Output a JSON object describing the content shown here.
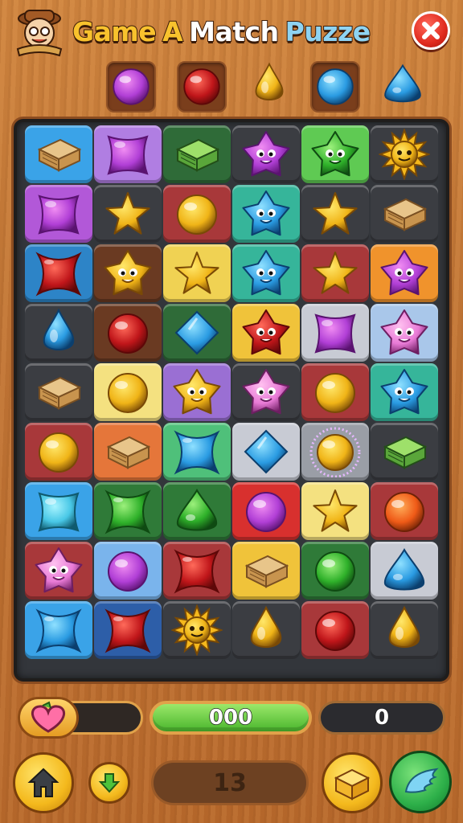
{
  "header": {
    "title_words": [
      {
        "text": "Game",
        "color": "#f8c22d"
      },
      {
        "text": "A",
        "color": "#f8c22d"
      },
      {
        "text": "Match",
        "color": "#ffffff"
      },
      {
        "text": "Puzze",
        "color": "#8ed3f2"
      }
    ],
    "logo_icon": "explorer-mascot-icon",
    "close_icon": "close-icon"
  },
  "next_row": [
    "purple-orb",
    "red-orb",
    "yellow-drop",
    "blue-orb",
    "blue-cone"
  ],
  "board": {
    "rows": 9,
    "cols": 6,
    "cells": [
      [
        {
          "bg": "#3aa3e8",
          "g": "crate"
        },
        {
          "bg": "#b07ee2",
          "g": "purple-square"
        },
        {
          "bg": "#2f6b38",
          "g": "green-crate"
        },
        {
          "bg": "#3b3d42",
          "g": "purple-star-creature"
        },
        {
          "bg": "#5fca53",
          "g": "green-star-creature"
        },
        {
          "bg": "#3b3d42",
          "g": "sun"
        }
      ],
      [
        {
          "bg": "#b258d8",
          "g": "purple-square"
        },
        {
          "bg": "#3b3d42",
          "g": "yellow-star"
        },
        {
          "bg": "#a8383a",
          "g": "yellow-orb"
        },
        {
          "bg": "#36b59a",
          "g": "blue-star-creature"
        },
        {
          "bg": "#3b3d42",
          "g": "yellow-star"
        },
        {
          "bg": "#3b3d42",
          "g": "crate"
        }
      ],
      [
        {
          "bg": "#2d84c7",
          "g": "red-cross"
        },
        {
          "bg": "#6a3a22",
          "g": "yellow-star-creature"
        },
        {
          "bg": "#f0d253",
          "g": "yellow-star"
        },
        {
          "bg": "#36b59a",
          "g": "blue-star-creature"
        },
        {
          "bg": "#a8383a",
          "g": "yellow-star"
        },
        {
          "bg": "#f0932c",
          "g": "purple-star-creature"
        }
      ],
      [
        {
          "bg": "#3b3d42",
          "g": "blue-drop"
        },
        {
          "bg": "#6a3a22",
          "g": "red-orb"
        },
        {
          "bg": "#2f6b38",
          "g": "blue-diamond"
        },
        {
          "bg": "#f0c33a",
          "g": "red-star-creature"
        },
        {
          "bg": "#c8cbd4",
          "g": "purple-square"
        },
        {
          "bg": "#a9c7ea",
          "g": "pink-star-creature"
        }
      ],
      [
        {
          "bg": "#3b3d42",
          "g": "crate"
        },
        {
          "bg": "#f4e180",
          "g": "yellow-orb"
        },
        {
          "bg": "#9a6fd3",
          "g": "yellow-star-creature"
        },
        {
          "bg": "#3b3d42",
          "g": "pink-star-creature"
        },
        {
          "bg": "#a8383a",
          "g": "yellow-orb"
        },
        {
          "bg": "#36b59a",
          "g": "blue-star-creature"
        }
      ],
      [
        {
          "bg": "#a8383a",
          "g": "yellow-orb"
        },
        {
          "bg": "#e5763a",
          "g": "crate"
        },
        {
          "bg": "#4fc07a",
          "g": "blue-cross"
        },
        {
          "bg": "#c8cbd4",
          "g": "blue-diamond"
        },
        {
          "bg": "#9a9ea6",
          "g": "glowing-purple-orb"
        },
        {
          "bg": "#3b3d42",
          "g": "green-crate"
        }
      ],
      [
        {
          "bg": "#3aa3e8",
          "g": "teal-square"
        },
        {
          "bg": "#2f7a38",
          "g": "green-cross"
        },
        {
          "bg": "#2f7a38",
          "g": "green-cone"
        },
        {
          "bg": "#d8302e",
          "g": "purple-orb"
        },
        {
          "bg": "#f4e180",
          "g": "yellow-star"
        },
        {
          "bg": "#a8383a",
          "g": "orange-orb"
        }
      ],
      [
        {
          "bg": "#a8383a",
          "g": "pink-star-creature"
        },
        {
          "bg": "#7ab4ec",
          "g": "purple-orb"
        },
        {
          "bg": "#a8383a",
          "g": "red-cross"
        },
        {
          "bg": "#f0c33a",
          "g": "crate"
        },
        {
          "bg": "#2f7a38",
          "g": "green-orb"
        },
        {
          "bg": "#c8cbd4",
          "g": "blue-cone"
        }
      ],
      [
        {
          "bg": "#3aa3e8",
          "g": "blue-cross"
        },
        {
          "bg": "#2d5ea8",
          "g": "red-cross"
        },
        {
          "bg": "#3b3d42",
          "g": "sun"
        },
        {
          "bg": "#3b3d42",
          "g": "yellow-drop"
        },
        {
          "bg": "#a8383a",
          "g": "red-orb"
        },
        {
          "bg": "#3b3d42",
          "g": "yellow-drop"
        }
      ]
    ]
  },
  "hud": {
    "lives_icon": "heart-icon",
    "score": "000",
    "counter": "0",
    "level": "13",
    "buttons": {
      "home_icon": "home-icon",
      "down_icon": "down-arrow-icon",
      "chest_icon": "chest-icon",
      "boost_icon": "wing-icon"
    }
  }
}
